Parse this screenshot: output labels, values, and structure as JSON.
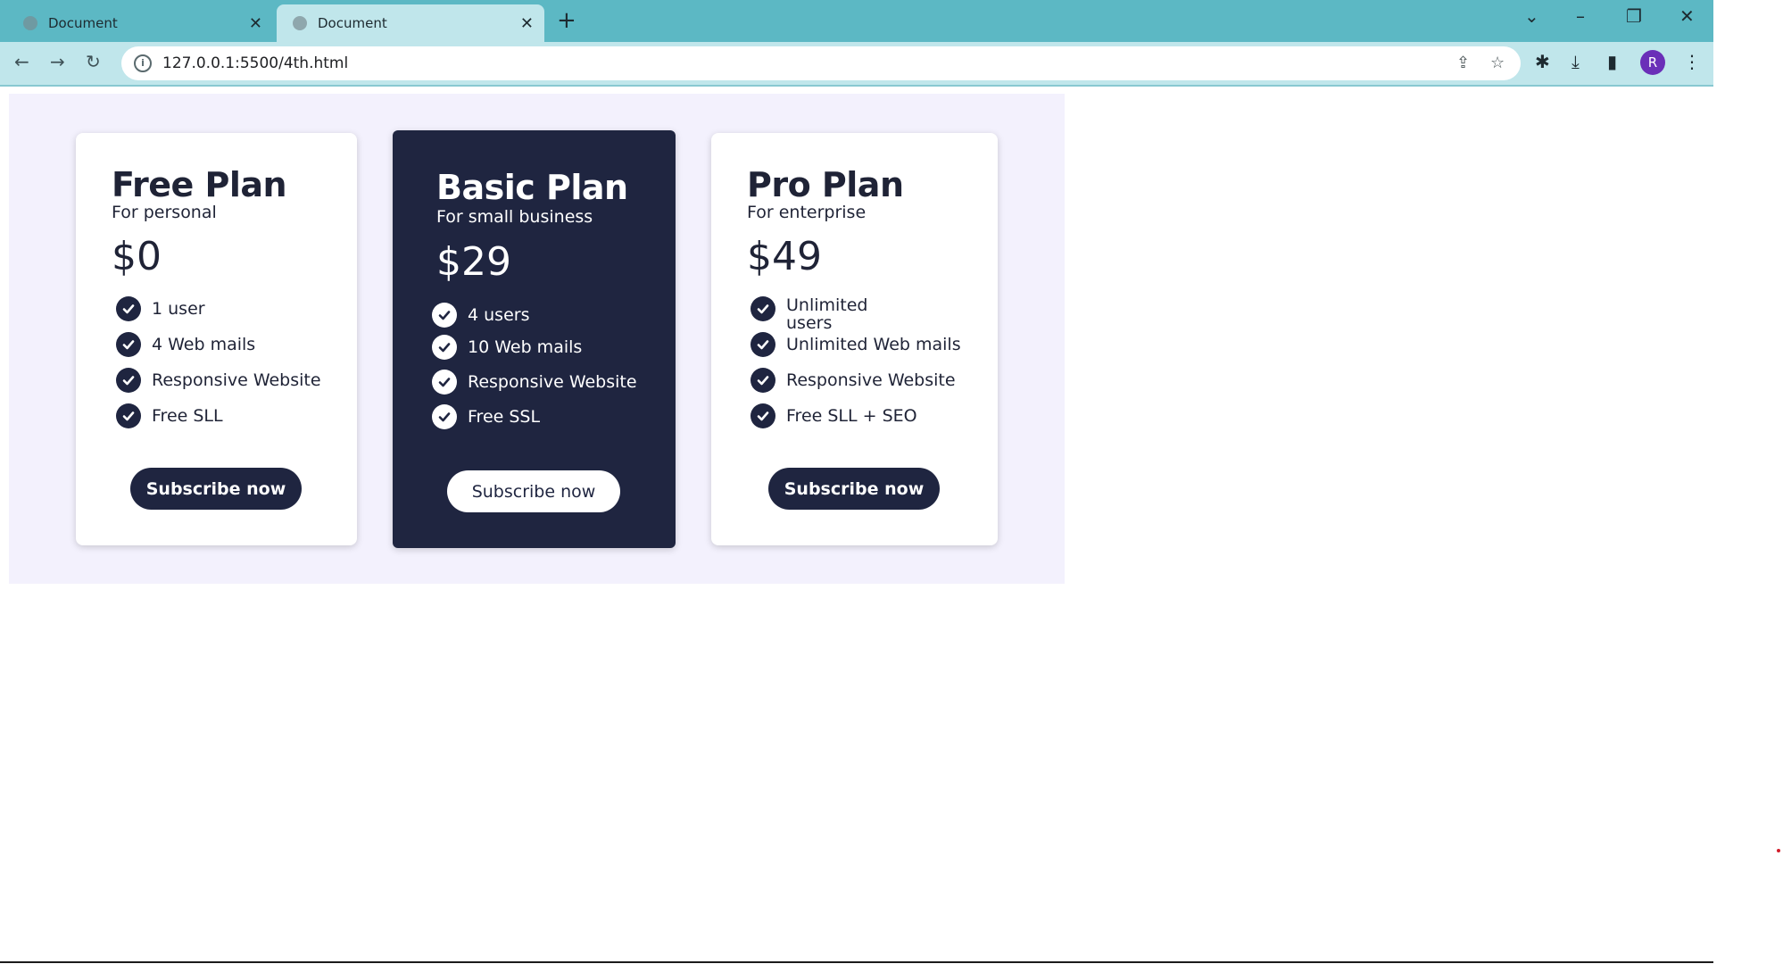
{
  "browser": {
    "tabs": [
      {
        "title": "Document",
        "active": false
      },
      {
        "title": "Document",
        "active": true
      }
    ],
    "url": "127.0.0.1:5500/4th.html",
    "profile_initial": "R"
  },
  "pricing": {
    "plans": [
      {
        "name": "Free Plan",
        "subtitle": "For personal",
        "price": "$0",
        "features": [
          "1 user",
          "4 Web mails",
          "Responsive Website",
          "Free SLL"
        ],
        "button": "Subscribe now",
        "highlighted": false
      },
      {
        "name": "Basic Plan",
        "subtitle": "For small business",
        "price": "$29",
        "features": [
          "4 users",
          "10 Web mails",
          "Responsive Website",
          "Free SSL"
        ],
        "button": "Subscribe now",
        "highlighted": true
      },
      {
        "name": "Pro Plan",
        "subtitle": "For enterprise",
        "price": "$49",
        "features": [
          "Unlimited users",
          "Unlimited Web mails",
          "Responsive Website",
          "Free SLL + SEO"
        ],
        "button": "Subscribe now",
        "highlighted": false
      }
    ]
  },
  "colors": {
    "tab_bar": "#5cb8c4",
    "toolbar": "#c0e6eb",
    "section_bg": "#f3f1fd",
    "dark_card": "#1f2540",
    "avatar": "#6a2fb8"
  }
}
